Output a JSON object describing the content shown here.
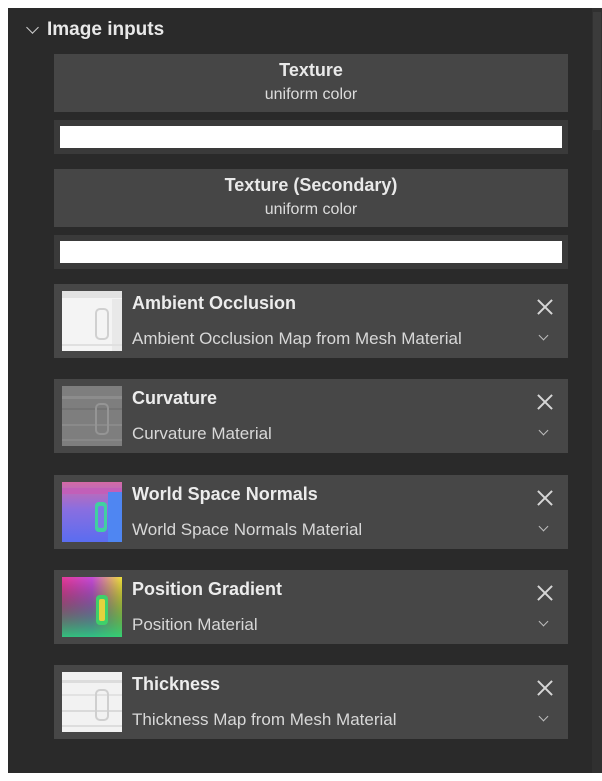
{
  "section": {
    "title": "Image inputs",
    "icon": "chevron-down-icon"
  },
  "texture": {
    "title": "Texture",
    "subtitle": "uniform color",
    "color": "#ffffff"
  },
  "texture_secondary": {
    "title": "Texture (Secondary)",
    "subtitle": "uniform color",
    "color": "#ffffff"
  },
  "inputs": [
    {
      "title": "Ambient Occlusion",
      "source": "Ambient Occlusion Map from Mesh Material",
      "thumbnail": "ambient-occlusion-thumbnail"
    },
    {
      "title": "Curvature",
      "source": "Curvature Material",
      "thumbnail": "curvature-thumbnail"
    },
    {
      "title": "World Space Normals",
      "source": "World Space Normals Material",
      "thumbnail": "world-space-normals-thumbnail"
    },
    {
      "title": "Position Gradient",
      "source": "Position Material",
      "thumbnail": "position-gradient-thumbnail"
    },
    {
      "title": "Thickness",
      "source": "Thickness Map from Mesh Material",
      "thumbnail": "thickness-thumbnail"
    }
  ],
  "colors": {
    "panel_bg": "#2a2a2a",
    "card_bg": "#474747",
    "text": "#e6e6e6"
  }
}
